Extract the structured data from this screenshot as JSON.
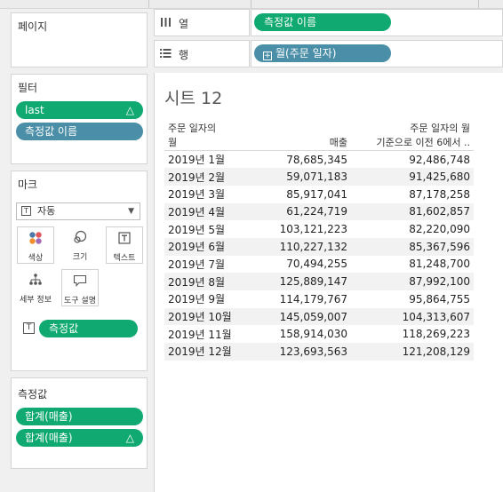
{
  "shelves": {
    "pages": {
      "title": "페이지"
    },
    "columns": {
      "label": "열",
      "pills": [
        {
          "text": "측정값 이름"
        }
      ]
    },
    "rows": {
      "label": "행",
      "pills": [
        {
          "text": "월(주문 일자)",
          "prefix_icon": "plus-box-icon"
        }
      ]
    }
  },
  "filters": {
    "title": "필터",
    "pills": [
      {
        "text": "last",
        "color": "#11a972",
        "delta": "△"
      },
      {
        "text": "측정값 이름",
        "color": "#4a8ea7"
      }
    ]
  },
  "marks": {
    "title": "마크",
    "mark_type": "자동",
    "buttons": [
      {
        "label": "색상",
        "icon": "color-dots-icon"
      },
      {
        "label": "크기",
        "icon": "size-circles-icon"
      },
      {
        "label": "텍스트",
        "icon": "text-box-icon"
      },
      {
        "label": "세부 정보",
        "icon": "detail-tree-icon"
      },
      {
        "label": "도구 설명",
        "icon": "tooltip-bubble-icon"
      }
    ],
    "text_pill": "측정값"
  },
  "measure_values": {
    "title": "측정값",
    "pills": [
      {
        "text": "합계(매출)"
      },
      {
        "text": "합계(매출)",
        "delta": "△"
      }
    ]
  },
  "sheet": {
    "title": "시트 12",
    "headers": {
      "col1_line1": "주문 일자의",
      "col1_line2": "월",
      "col2": "매출",
      "col3_line1": "주문 일자의 월",
      "col3_line2": "기준으로 이전 6에서 .."
    },
    "rows": [
      {
        "month": "2019년 1월",
        "sales": "78,685,345",
        "prev": "92,486,748"
      },
      {
        "month": "2019년 2월",
        "sales": "59,071,183",
        "prev": "91,425,680"
      },
      {
        "month": "2019년 3월",
        "sales": "85,917,041",
        "prev": "87,178,258"
      },
      {
        "month": "2019년 4월",
        "sales": "61,224,719",
        "prev": "81,602,857"
      },
      {
        "month": "2019년 5월",
        "sales": "103,121,223",
        "prev": "82,220,090"
      },
      {
        "month": "2019년 6월",
        "sales": "110,227,132",
        "prev": "85,367,596"
      },
      {
        "month": "2019년 7월",
        "sales": "70,494,255",
        "prev": "81,248,700"
      },
      {
        "month": "2019년 8월",
        "sales": "125,889,147",
        "prev": "87,992,100"
      },
      {
        "month": "2019년 9월",
        "sales": "114,179,767",
        "prev": "95,864,755"
      },
      {
        "month": "2019년 10월",
        "sales": "145,059,007",
        "prev": "104,313,607"
      },
      {
        "month": "2019년 11월",
        "sales": "158,914,030",
        "prev": "118,269,223"
      },
      {
        "month": "2019년 12월",
        "sales": "123,693,563",
        "prev": "121,208,129"
      }
    ]
  },
  "colors": {
    "green_pill": "#11a972",
    "blue_pill": "#4a8ea7"
  }
}
